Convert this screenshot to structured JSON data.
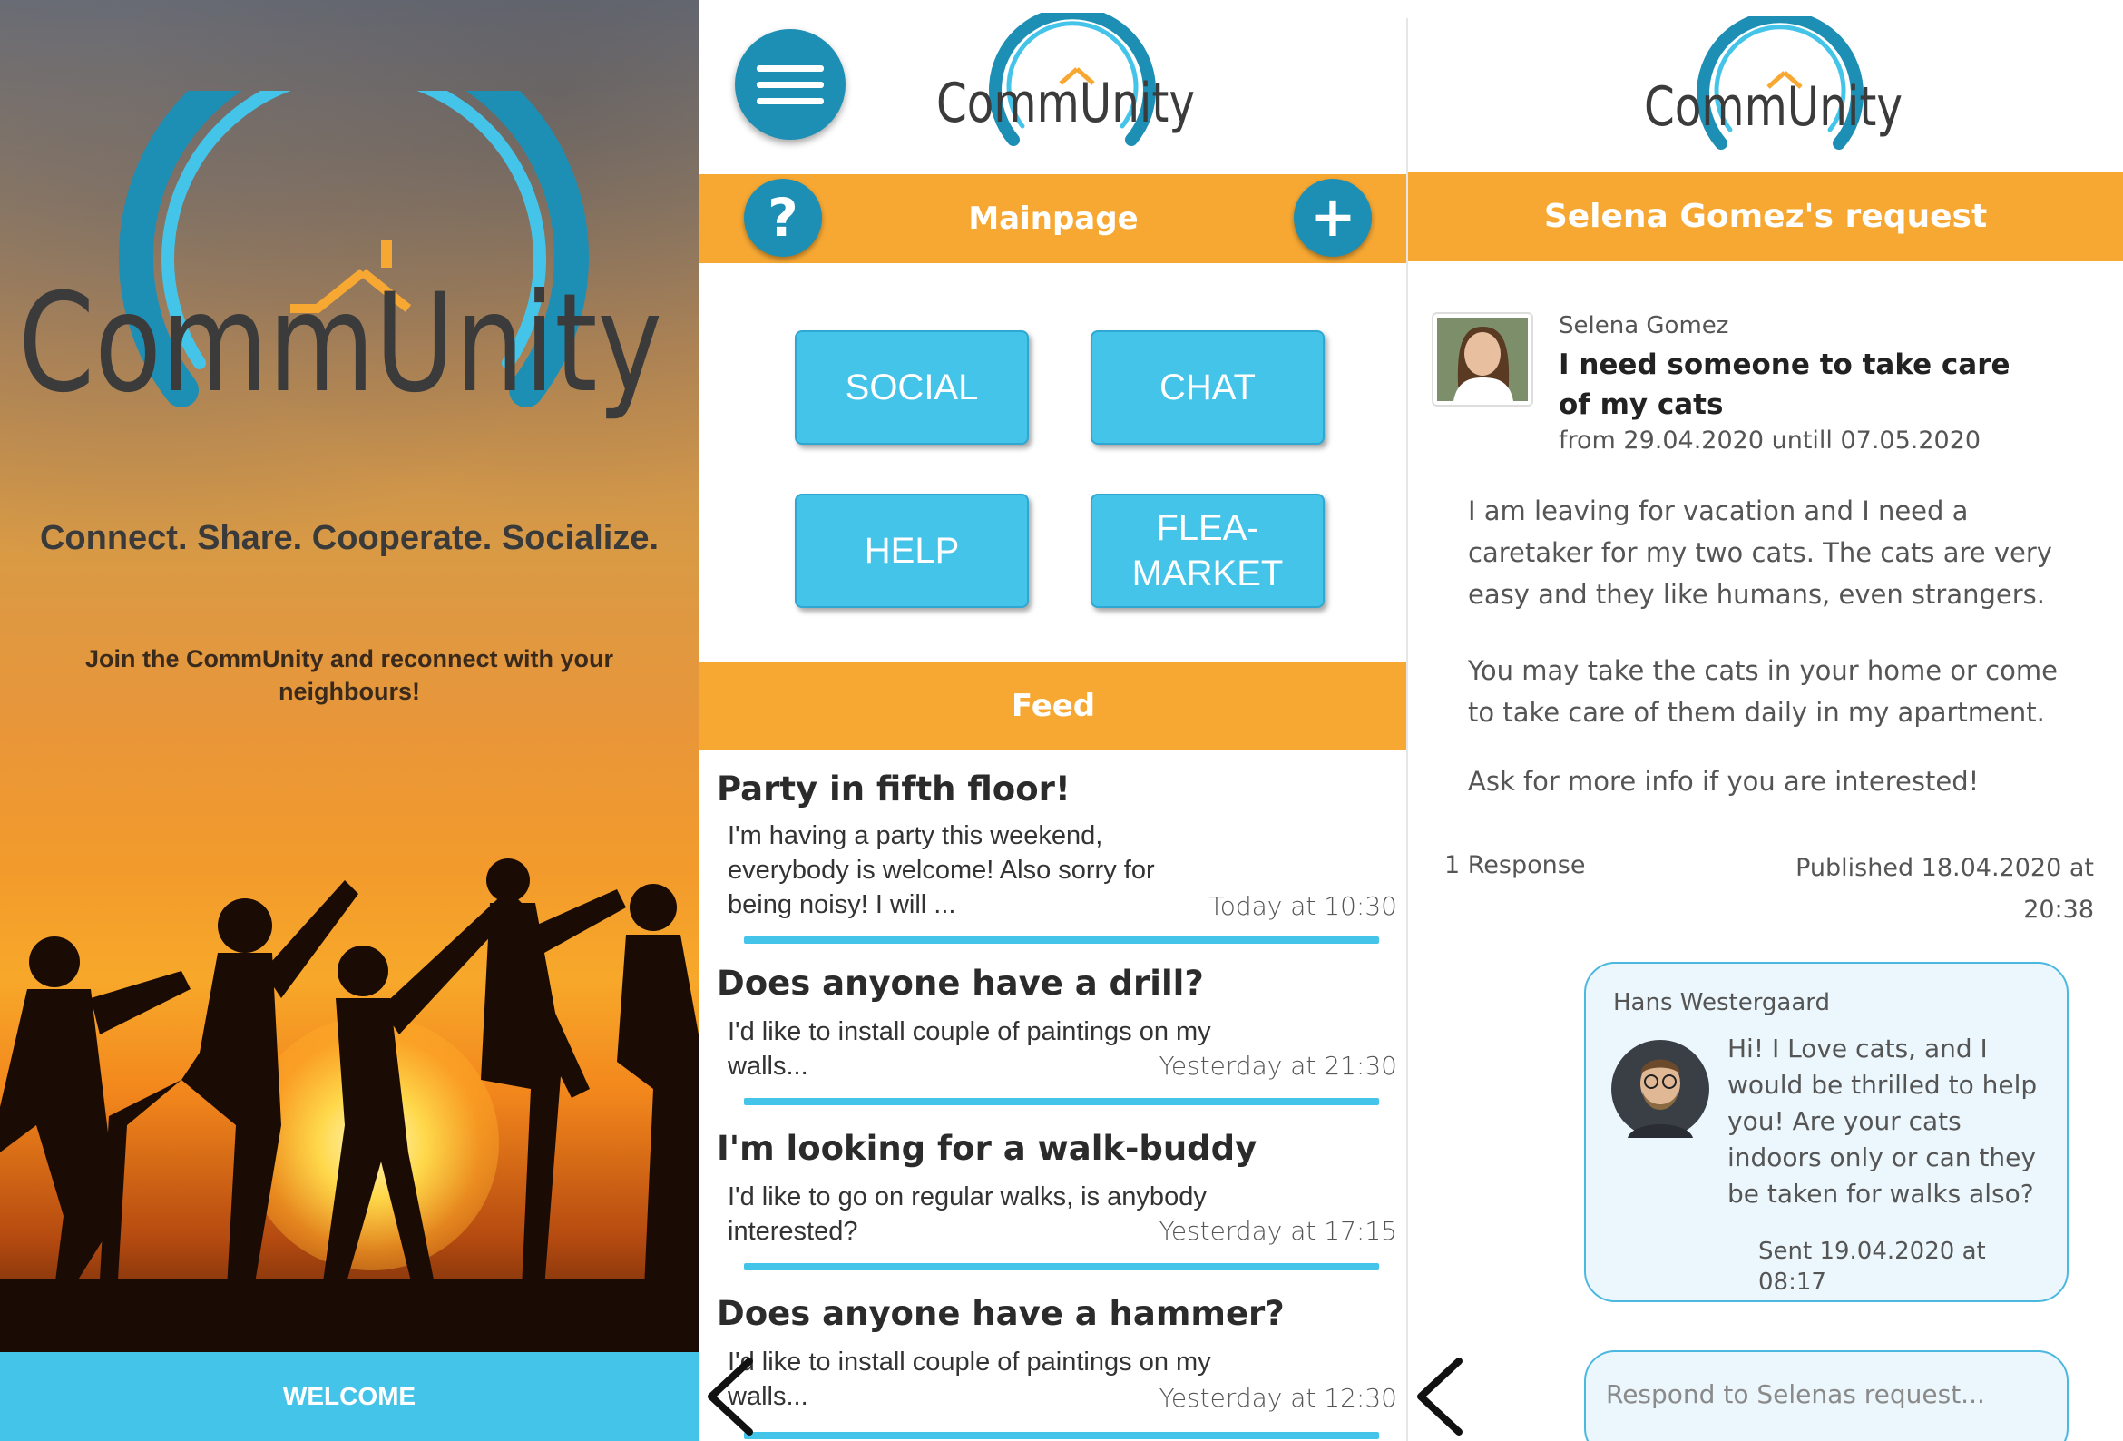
{
  "brand": {
    "logo_text": "CommUnity",
    "primary_color": "#45c4ea",
    "accent_color": "#f7a833",
    "dark_blue": "#1e8fb4"
  },
  "welcome_screen": {
    "tagline": "Connect. Share. Cooperate. Socialize.",
    "join_text": "Join the CommUnity and reconnect with your neighbours!",
    "welcome_button": "WELCOME"
  },
  "main_screen": {
    "menu_icon": "hamburger-menu-icon",
    "help_icon": "question-mark-icon",
    "add_icon": "plus-icon",
    "header_title": "Mainpage",
    "nav_buttons": [
      "SOCIAL",
      "CHAT",
      "HELP",
      "FLEA-MARKET"
    ],
    "feed_title": "Feed",
    "feed": [
      {
        "title": "Party in fifth floor!",
        "body": "I'm having a party this weekend, everybody is welcome! Also sorry for being noisy! I will ...",
        "time": "Today at 10:30"
      },
      {
        "title": "Does anyone have a drill?",
        "body": "I'd like to install couple of paintings on my walls...",
        "time": "Yesterday at 21:30"
      },
      {
        "title": "I'm looking for a walk-buddy",
        "body": "I'd like to go on regular walks, is anybody interested?",
        "time": "Yesterday at 17:15"
      },
      {
        "title": "Does anyone have a hammer?",
        "body": "I'd like to install couple of paintings on my walls...",
        "time": "Yesterday at 12:30"
      }
    ]
  },
  "request_screen": {
    "header_title": "Selena Gomez's request",
    "author": "Selena Gomez",
    "request_title": "I need someone to take care of my cats",
    "date_range": "from 29.04.2020 untill 07.05.2020",
    "paragraphs": [
      "I am leaving for vacation and I need a caretaker for my two cats. The cats are very easy and they like humans, even strangers.",
      "You may take the cats in your home or come to take care of them daily in my apartment.",
      "Ask for more info if you are interested!"
    ],
    "responses_count": "1 Response",
    "published": "Published 18.04.2020 at 20:38",
    "response": {
      "author": "Hans Westergaard",
      "text": "Hi! I Love cats, and I would be thrilled to help you! Are your cats indoors only or can they be taken for walks also?",
      "sent": "Sent 19.04.2020 at 08:17"
    },
    "respond_placeholder": "Respond to Selenas request..."
  }
}
